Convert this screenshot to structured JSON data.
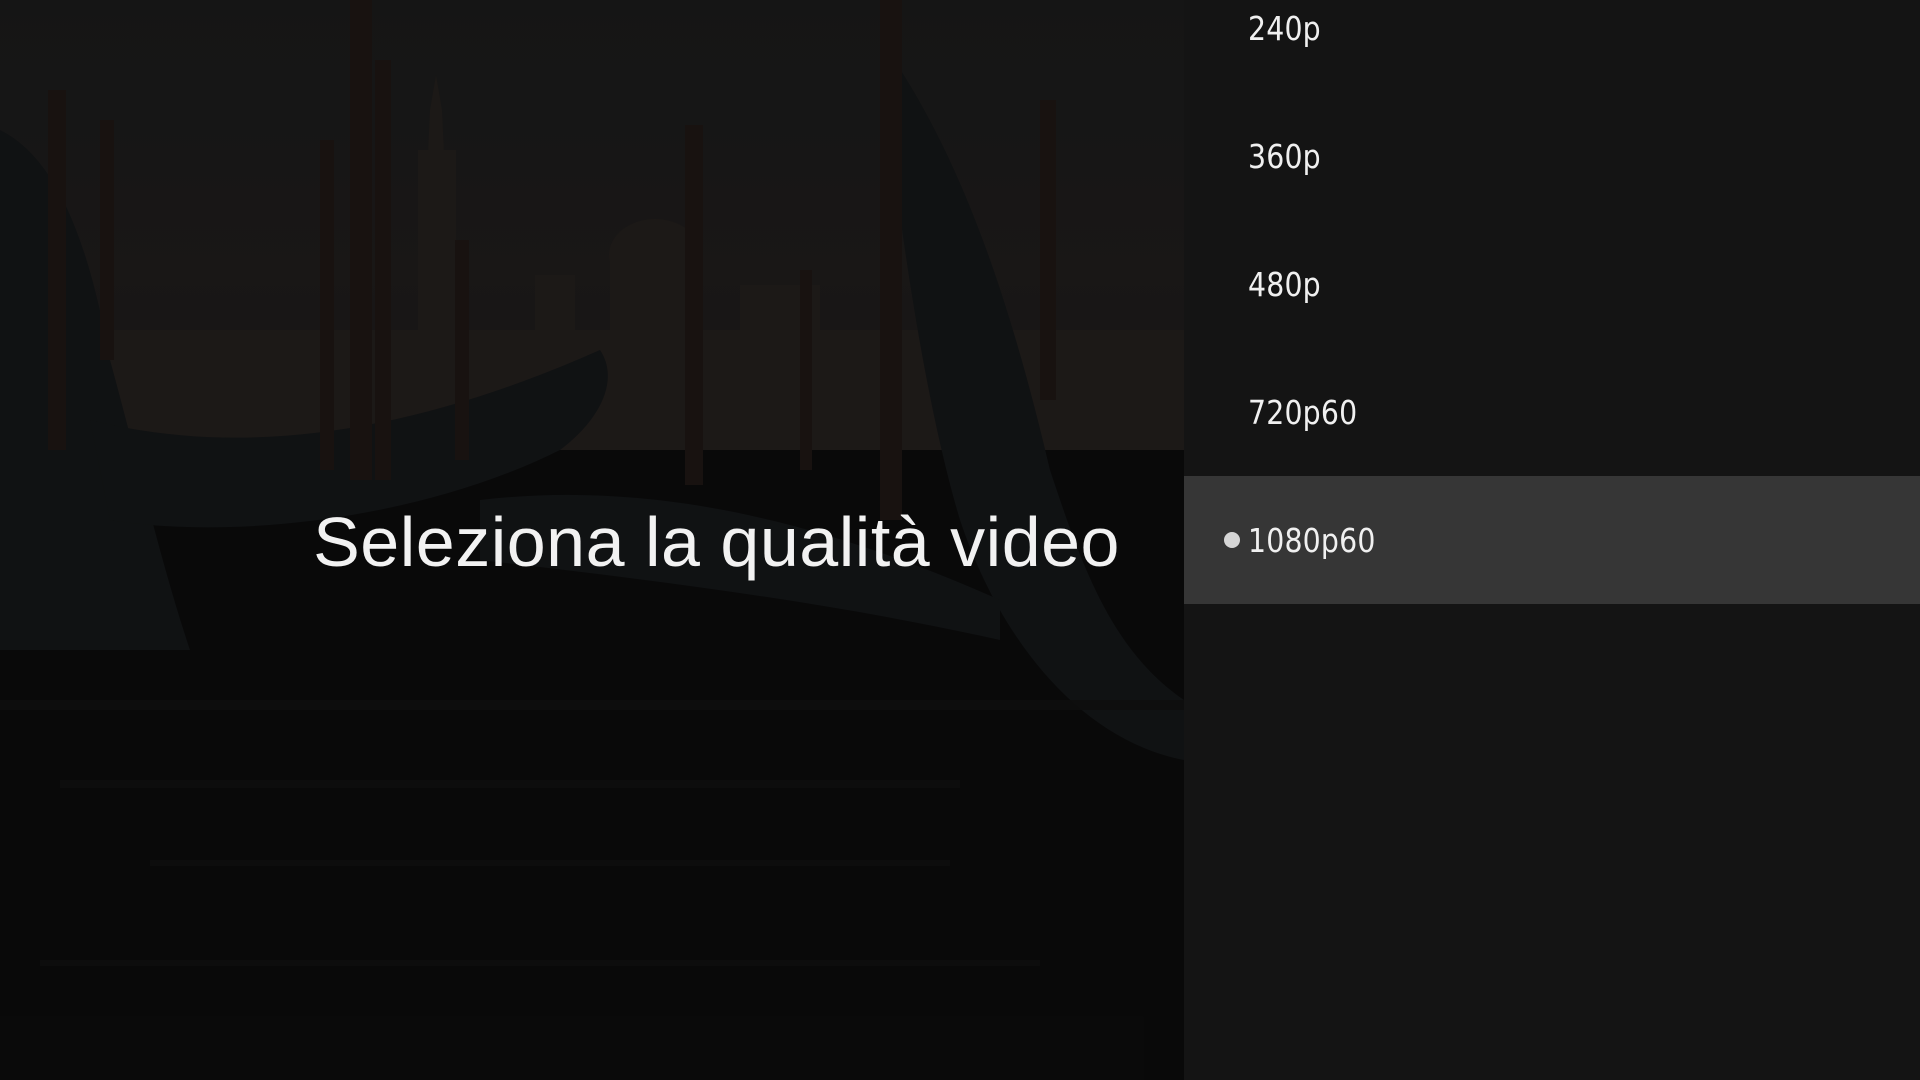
{
  "title": "Seleziona la qualità video",
  "quality_menu": {
    "items": [
      {
        "label": "240p",
        "selected": false
      },
      {
        "label": "360p",
        "selected": false
      },
      {
        "label": "480p",
        "selected": false
      },
      {
        "label": "720p60",
        "selected": false
      },
      {
        "label": "1080p60",
        "selected": true
      }
    ]
  },
  "colors": {
    "panel_background": "#141414",
    "selected_row": "#363636",
    "text": "#f0f0f0"
  },
  "icons": {
    "selected_indicator": "radio-dot-icon"
  }
}
